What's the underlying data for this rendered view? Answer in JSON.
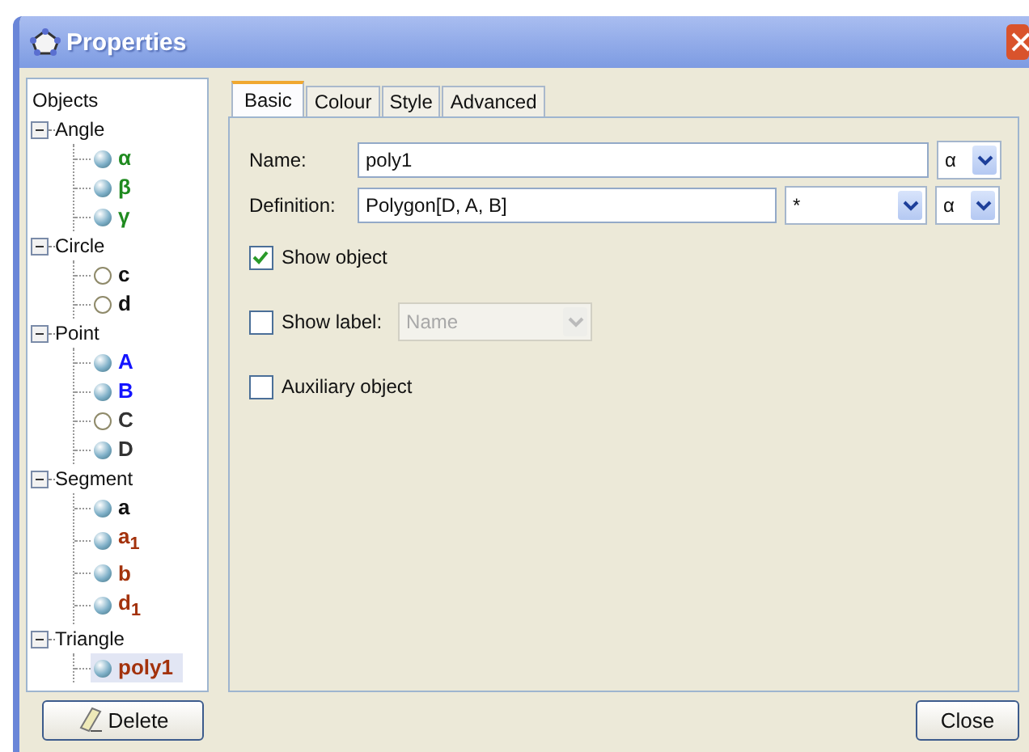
{
  "window": {
    "title": "Properties"
  },
  "tree": {
    "heading": "Objects",
    "groups": [
      {
        "label": "Angle",
        "expanded": true,
        "children": [
          {
            "label": "α",
            "color": "#1f8a1f",
            "shown": true,
            "selected": false
          },
          {
            "label": "β",
            "color": "#1f8a1f",
            "shown": true,
            "selected": false
          },
          {
            "label": "γ",
            "color": "#1f8a1f",
            "shown": true,
            "selected": false
          }
        ]
      },
      {
        "label": "Circle",
        "expanded": true,
        "children": [
          {
            "label": "c",
            "color": "#111111",
            "shown": false,
            "selected": false
          },
          {
            "label": "d",
            "color": "#111111",
            "shown": false,
            "selected": false
          }
        ]
      },
      {
        "label": "Point",
        "expanded": true,
        "children": [
          {
            "label": "A",
            "color": "#1414ff",
            "shown": true,
            "selected": false
          },
          {
            "label": "B",
            "color": "#1414ff",
            "shown": true,
            "selected": false
          },
          {
            "label": "C",
            "color": "#333333",
            "shown": false,
            "selected": false
          },
          {
            "label": "D",
            "color": "#333333",
            "shown": true,
            "selected": false
          }
        ]
      },
      {
        "label": "Segment",
        "expanded": true,
        "children": [
          {
            "label": "a",
            "color": "#111111",
            "shown": true,
            "selected": false
          },
          {
            "label": "a$_{1}$",
            "color": "#a3320c",
            "shown": true,
            "selected": false
          },
          {
            "label": "b",
            "color": "#a3320c",
            "shown": true,
            "selected": false
          },
          {
            "label": "d$_{1}$",
            "color": "#a3320c",
            "shown": true,
            "selected": false
          }
        ]
      },
      {
        "label": "Triangle",
        "expanded": true,
        "children": [
          {
            "label": "poly1",
            "color": "#a3320c",
            "shown": true,
            "selected": true
          }
        ]
      }
    ]
  },
  "tabs": [
    {
      "label": "Basic",
      "selected": true
    },
    {
      "label": "Colour",
      "selected": false
    },
    {
      "label": "Style",
      "selected": false
    },
    {
      "label": "Advanced",
      "selected": false
    }
  ],
  "fields": {
    "name": {
      "label": "Name:",
      "value": "poly1",
      "symbol": "α"
    },
    "definition": {
      "label": "Definition:",
      "value": "Polygon[D, A, B]",
      "operator": "*",
      "symbol": "α"
    }
  },
  "checkboxes": [
    {
      "label": "Show object",
      "checked": true
    },
    {
      "label": "Show label:",
      "checked": false,
      "dropdown": {
        "value": "Name",
        "disabled": true
      }
    },
    {
      "label": "Auxiliary object",
      "checked": false
    }
  ],
  "buttons": {
    "delete": "Delete",
    "close": "Close"
  }
}
